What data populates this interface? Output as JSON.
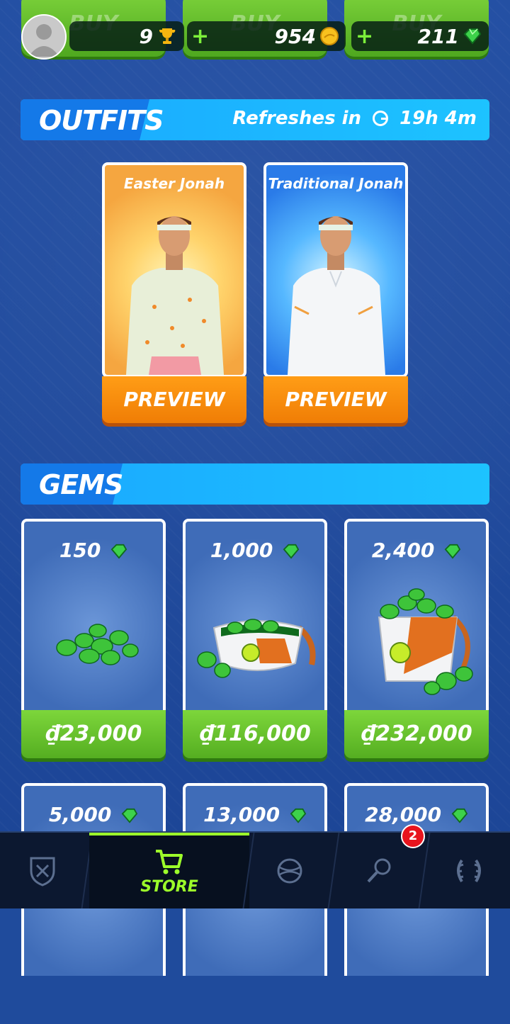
{
  "hud": {
    "buy_labels": [
      "BUY",
      "BUY",
      "BUY"
    ],
    "trophies": "9",
    "coins": "954",
    "gems": "211"
  },
  "outfits": {
    "title": "OUTFITS",
    "refresh_label": "Refreshes in",
    "refresh_time": "19h 4m",
    "items": [
      {
        "name": "Easter Jonah",
        "button": "PREVIEW"
      },
      {
        "name": "Traditional Jonah",
        "button": "PREVIEW"
      }
    ]
  },
  "gems": {
    "title": "GEMS",
    "packs": [
      {
        "amount": "150",
        "price": "₫23,000"
      },
      {
        "amount": "1,000",
        "price": "₫116,000"
      },
      {
        "amount": "2,400",
        "price": "₫232,000"
      },
      {
        "amount": "5,000"
      },
      {
        "amount": "13,000"
      },
      {
        "amount": "28,000"
      }
    ]
  },
  "nav": {
    "store_label": "STORE",
    "badge_count": "2",
    "icons": [
      "crest-icon",
      "cart-icon",
      "ball-icon",
      "racket-icon",
      "laurel-icon"
    ]
  },
  "colors": {
    "accent_green": "#9dff2a",
    "orange_button": "#ff9d16",
    "section_blue": "#1dc3ff"
  }
}
